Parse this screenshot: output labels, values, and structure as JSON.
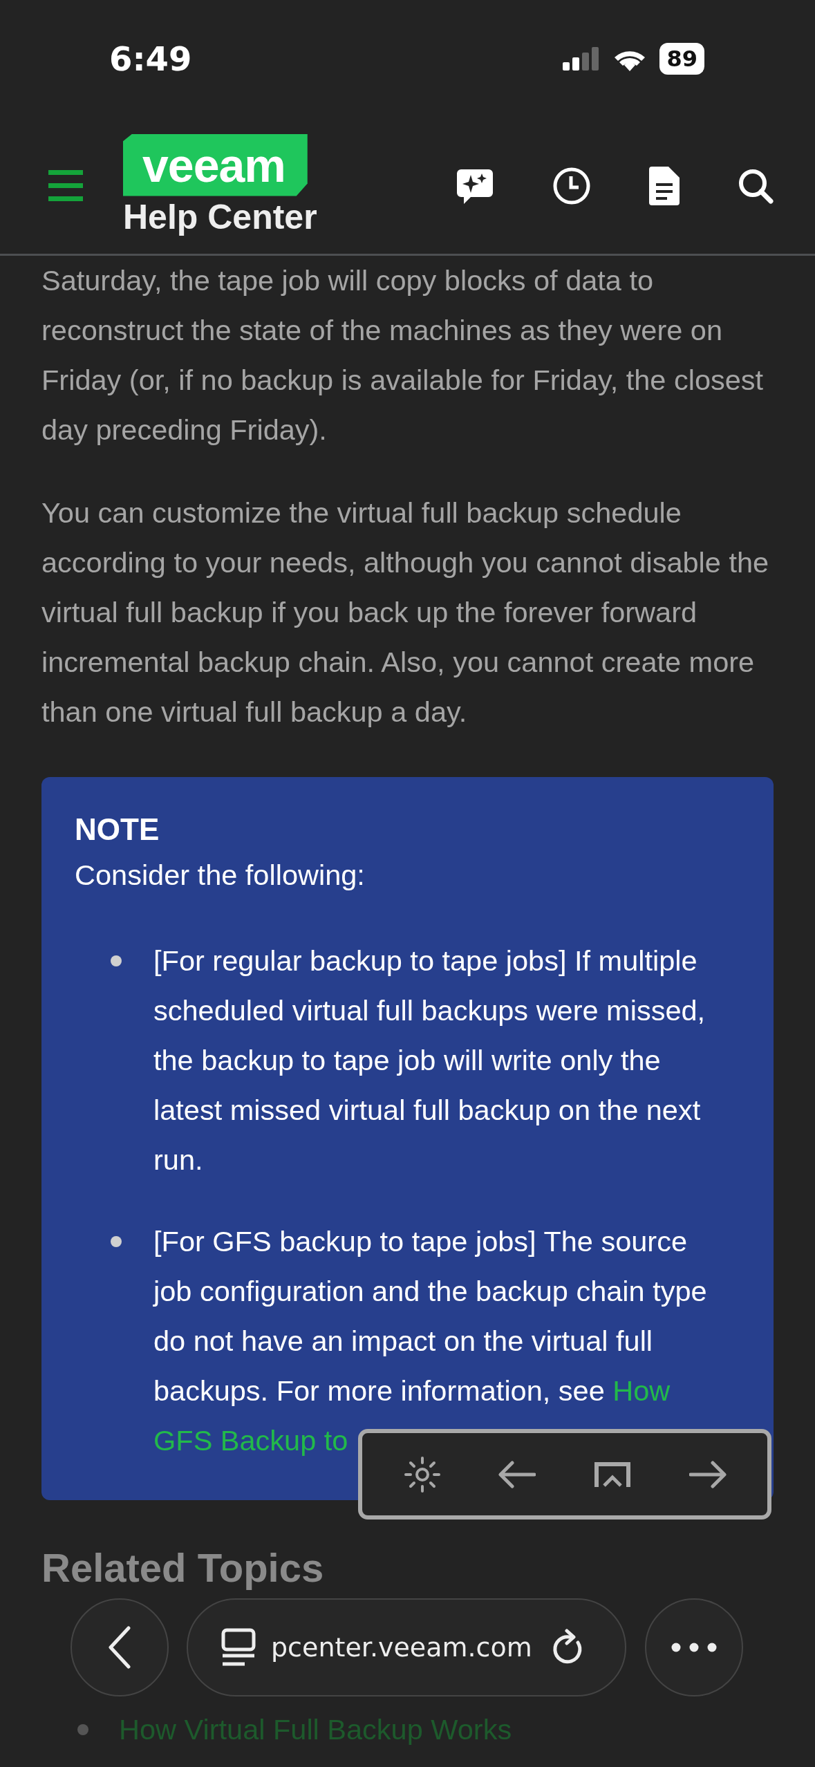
{
  "status_bar": {
    "time": "6:49",
    "battery": "89"
  },
  "header": {
    "logo": "veeam",
    "subtitle": "Help Center"
  },
  "article": {
    "paragraphs": [
      "Saturday, the tape job will copy blocks of data to reconstruct the state of the machines as they were on Friday (or, if no backup is available for Friday, the closest day preceding Friday).",
      "You can customize the virtual full backup schedule according to your needs, although you cannot disable the virtual full backup if you back up the forever forward incremental backup chain. Also, you cannot create more than one virtual full backup a day."
    ],
    "note": {
      "title": "NOTE",
      "intro": "Consider the following:",
      "items": [
        {
          "text": "[For regular backup to tape jobs] If multiple scheduled virtual full backups were missed, the backup to tape job will write only the latest missed virtual full backup on the next run."
        },
        {
          "text": "[For GFS backup to tape jobs] The source job configuration and the backup chain type do not have an impact on the virtual full backups. For more information, see",
          "link": [
            "How",
            "GFS Backup to"
          ]
        }
      ]
    }
  },
  "related": {
    "heading": "Related Topics",
    "links": [
      "How Virtual Full Backup Works"
    ]
  },
  "browser_bar": {
    "url": "pcenter.veeam.com"
  }
}
